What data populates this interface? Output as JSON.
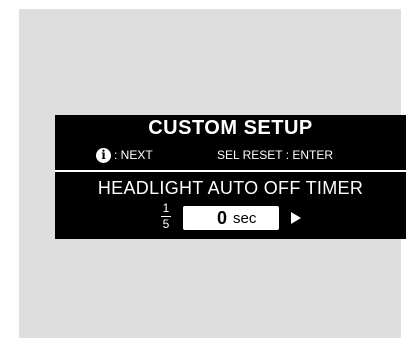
{
  "screen": {
    "title": "CUSTOM SETUP",
    "info_icon_glyph": "i",
    "info_icon": "info-icon",
    "next_label": ": NEXT",
    "reset_label": "SEL RESET : ENTER",
    "setting_name": "HEADLIGHT AUTO OFF TIMER",
    "page": {
      "current": "1",
      "total": "5"
    },
    "value": "0",
    "unit": "sec",
    "arrow_icon": "right-arrow-icon"
  },
  "colors": {
    "background": "#dedede",
    "display": "#000000",
    "text": "#ffffff"
  }
}
